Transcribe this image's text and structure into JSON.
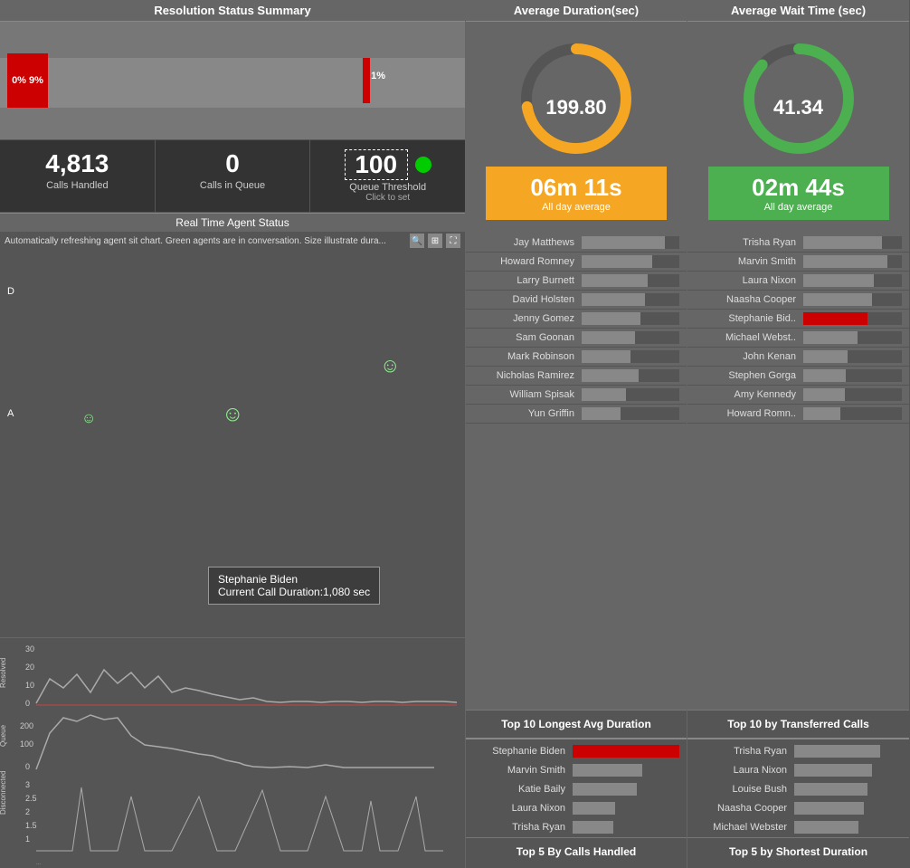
{
  "left": {
    "resolution_header": "Resolution Status Summary",
    "red_label_left": "0% 9%",
    "red_label_right": "1%",
    "calls_handled_value": "4,813",
    "calls_handled_label": "Calls Handled",
    "calls_in_queue_value": "0",
    "calls_in_queue_label": "Calls in Queue",
    "queue_threshold_value": "100",
    "queue_threshold_label": "Queue Threshold",
    "queue_threshold_sublabel": "Click to set",
    "agent_status_header": "Real Time Agent Status",
    "agent_desc": "Automatically refreshing agent sit chart. Green agents are in conversation. Size illustrate dura...",
    "agent_d_label": "D",
    "agent_a_label": "A",
    "tooltip_name": "Stephanie Biden",
    "tooltip_duration": "Current Call Duration:1,080 sec"
  },
  "mid": {
    "avg_duration_header": "Average Duration(sec)",
    "gauge_value": "199.80",
    "avg_time": "06m 11s",
    "avg_label": "All day average",
    "agents": [
      {
        "name": "Jay Matthews",
        "bar": 85
      },
      {
        "name": "Howard Romney",
        "bar": 72
      },
      {
        "name": "Larry Burnett",
        "bar": 68
      },
      {
        "name": "David Holsten",
        "bar": 65
      },
      {
        "name": "Jenny Gomez",
        "bar": 60
      },
      {
        "name": "Sam Goonan",
        "bar": 55
      },
      {
        "name": "Mark Robinson",
        "bar": 50
      },
      {
        "name": "Nicholas Ramirez",
        "bar": 58
      },
      {
        "name": "William Spisak",
        "bar": 45
      },
      {
        "name": "Yun Griffin",
        "bar": 40
      }
    ],
    "list_btn": "Top 10 Longest Avg Duration",
    "top5_header": "Top 5 By Calls Handled",
    "top5": [
      {
        "name": "Stephanie Biden",
        "bar": 100,
        "type": "red"
      },
      {
        "name": "Marvin Smith",
        "bar": 65
      },
      {
        "name": "Katie Baily",
        "bar": 60
      },
      {
        "name": "Laura Nixon",
        "bar": 40
      },
      {
        "name": "Trisha Ryan",
        "bar": 38
      }
    ]
  },
  "right": {
    "avg_wait_header": "Average Wait Time (sec)",
    "gauge_value": "41.34",
    "avg_time": "02m 44s",
    "avg_label": "All day average",
    "agents": [
      {
        "name": "Trisha Ryan",
        "bar": 80
      },
      {
        "name": "Marvin Smith",
        "bar": 85
      },
      {
        "name": "Laura Nixon",
        "bar": 72
      },
      {
        "name": "Naasha Cooper",
        "bar": 70
      },
      {
        "name": "Stephanie Bid..",
        "bar": 65,
        "type": "red"
      },
      {
        "name": "Michael Webst..",
        "bar": 55
      },
      {
        "name": "John Kenan",
        "bar": 45
      },
      {
        "name": "Stephen Gorga",
        "bar": 43
      },
      {
        "name": "Amy Kennedy",
        "bar": 42
      },
      {
        "name": "Howard Romn..",
        "bar": 38
      }
    ],
    "list_btn": "Top 10 by Transferred Calls",
    "top5_header": "Top 5 by Shortest Duration",
    "top5": [
      {
        "name": "Trisha Ryan",
        "bar": 80
      },
      {
        "name": "Laura Nixon",
        "bar": 72
      },
      {
        "name": "Louise Bush",
        "bar": 68
      },
      {
        "name": "Naasha Cooper",
        "bar": 65
      },
      {
        "name": "Michael Webster",
        "bar": 60
      }
    ]
  }
}
